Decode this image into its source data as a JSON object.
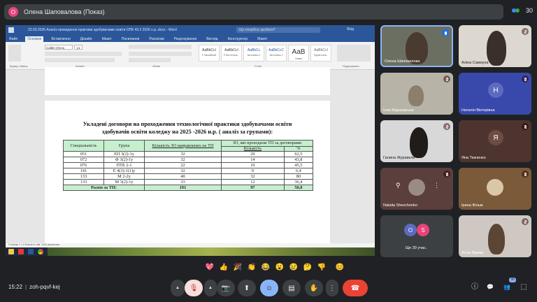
{
  "meeting": {
    "presenter_initial": "О",
    "presenter_label": "Олена Шаповалова (Показ)",
    "participant_count": "30",
    "time": "15:22",
    "meeting_code": "zoh-pqvf-kej"
  },
  "word": {
    "title": "23.03.2026 Аналіз проведення практики здобувачами освіти ОПК 43.2 2026 н.р..docx - Word",
    "search_placeholder": "Що потрібно зробити?",
    "user": "Вхід",
    "tabs": [
      "Файл",
      "Основне",
      "Вставлення",
      "Дизайн",
      "Макет",
      "Посилання",
      "Розсилки",
      "Рецензування",
      "Вигляд",
      "Конструктор",
      "Макет"
    ],
    "active_tab": "Основне",
    "font_name": "Calibri (Осно",
    "font_size": "11",
    "group_labels": [
      "Буфер обміну",
      "Шрифт",
      "Абзац",
      "Стилі",
      "Редагування"
    ],
    "styles": [
      {
        "preview": "AaBbCcI",
        "name": "¶ Звичайний"
      },
      {
        "preview": "AaBbCcI",
        "name": "¶ Без інтерв..."
      },
      {
        "preview": "AaBbCc",
        "name": "Заголовок 1"
      },
      {
        "preview": "AaBbCcC",
        "name": "Заголовок 2"
      },
      {
        "preview": "AaB",
        "name": "Назва"
      },
      {
        "preview": "AaBbCcI",
        "name": "Підзаголов..."
      }
    ],
    "status_text": "Сторінка 1 з 2   Кількість слів: 1440   українська",
    "page_number": "1"
  },
  "document": {
    "title_line1": "Укладені договори на проходження технологічної практики здобувачами освіти",
    "title_line2": "здобувачів освіти коледжу на 2025 -2026 н.р. ( аналіз за групами):",
    "headers": {
      "specialty": "Спеціальність",
      "group": "Група",
      "sent_count": "Кількість ЗО направлених на ТП",
      "passing": "ЗО, які проходили ТП за договорами",
      "count": "Кількість",
      "percent": "%"
    },
    "rows": [
      {
        "spec": "051",
        "group": "ЕП 3(2)-1у",
        "sent": "32",
        "count": "20",
        "pct": "62,5"
      },
      {
        "spec": "072",
        "group": "Ф 3(2)-1у",
        "sent": "32",
        "count": "14",
        "pct": "43,8"
      },
      {
        "spec": "076",
        "group": "ПТБ 2-1",
        "sent": "22",
        "count": "10",
        "pct": "45,5"
      },
      {
        "spec": "141",
        "group": "Е 4(3)-1(1)у",
        "sent": "32",
        "count": "9",
        "pct": "6,4"
      },
      {
        "spec": "133",
        "group": "М 2-2у",
        "sent": "40",
        "count": "32",
        "pct": "80"
      },
      {
        "spec": "133",
        "group": "М 3(2)-1у",
        "sent": "33",
        "count": "12",
        "pct": "36,4"
      }
    ],
    "total": {
      "label": "Разом за ТП:",
      "sent": "191",
      "count": "97",
      "pct": "50,8"
    }
  },
  "participants": [
    {
      "name": "Олена Шаповалова",
      "type": "video",
      "mic": "speaking"
    },
    {
      "name": "Аліна Самоуна",
      "type": "video",
      "mic": "muted"
    },
    {
      "name": "Інна Варшавська",
      "type": "video",
      "mic": "muted"
    },
    {
      "name": "Наталія Вікторівна",
      "type": "avatar",
      "initial": "Н",
      "color": "#3f51b5",
      "mic": "muted"
    },
    {
      "name": "Галина Журавель",
      "type": "video",
      "mic": "muted"
    },
    {
      "name": "Яна Ткаченко",
      "type": "avatar",
      "initial": "Я",
      "color": "#6d4c41",
      "mic": "muted"
    },
    {
      "name": "Natalia Shevchenko",
      "type": "video",
      "mic": "muted"
    },
    {
      "name": "Ірина Фільм",
      "type": "video",
      "mic": "muted"
    },
    {
      "name": "Ще 30 учас.",
      "type": "group",
      "initials": [
        "О",
        "S"
      ],
      "mic": "none"
    },
    {
      "name": "Алла Ярміш",
      "type": "video",
      "mic": "muted"
    }
  ],
  "reactions": [
    "💖",
    "👍",
    "🎉",
    "👏",
    "😂",
    "😮",
    "😢",
    "🤔",
    "👎",
    "😊"
  ],
  "controls": {
    "more_icon": "▲",
    "mic_icon": "🎙",
    "camera_icon": "📷",
    "present_icon": "⬆",
    "emoji_icon": "☺",
    "captions_icon": "▤",
    "hand_icon": "✋",
    "more_options_icon": "⋮",
    "leave_icon": "☎",
    "info_icon": "ⓘ",
    "chat_icon": "💬",
    "people_icon": "👥",
    "activities_icon": "⬚",
    "people_badge": "30"
  }
}
